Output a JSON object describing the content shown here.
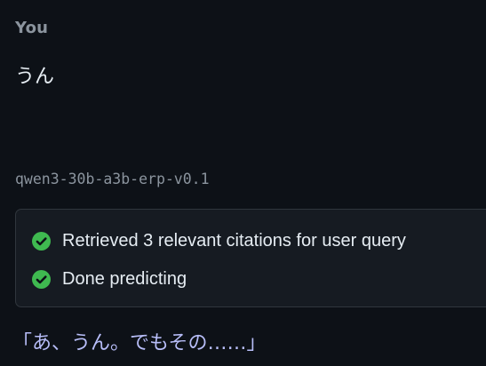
{
  "conversation": {
    "user": {
      "label": "You",
      "message": "うん"
    },
    "assistant": {
      "model": "qwen3-30b-a3b-erp-v0.1",
      "status": [
        {
          "icon": "check-circle-icon",
          "text": "Retrieved 3 relevant citations for user query"
        },
        {
          "icon": "check-circle-icon",
          "text": "Done predicting"
        }
      ],
      "message": "「あ、うん。でもその……」"
    }
  },
  "colors": {
    "background": "#0d1117",
    "status_box": "#161b22",
    "success_green": "#3fb950",
    "assistant_text": "#b7bdf8"
  }
}
